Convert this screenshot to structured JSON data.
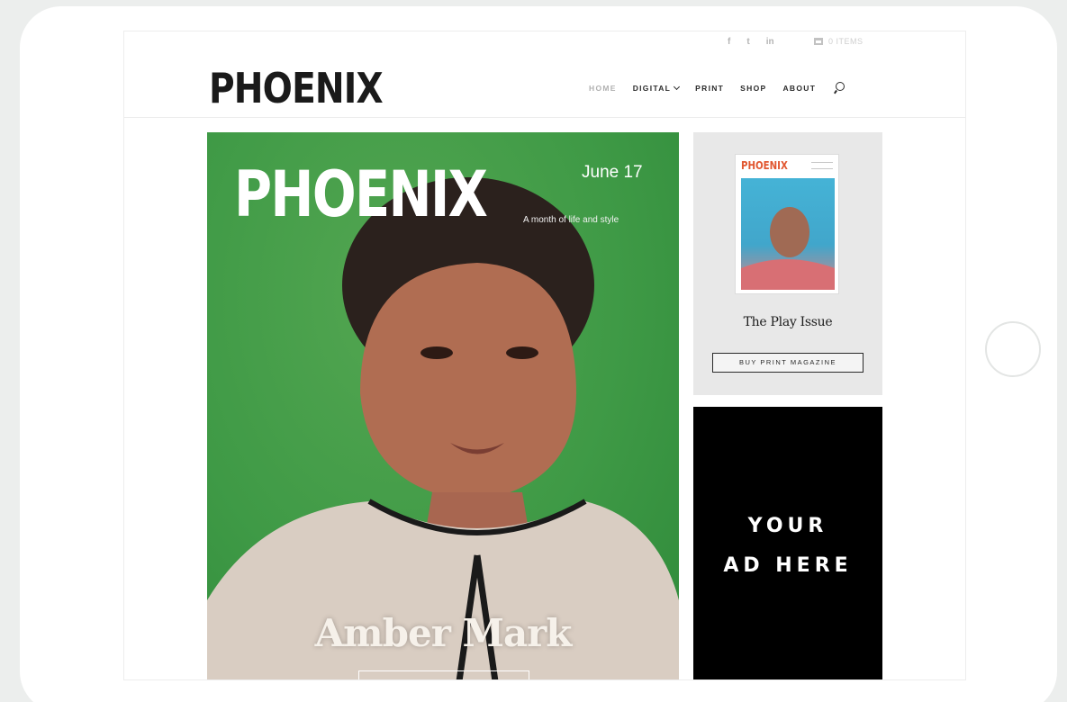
{
  "header": {
    "logo": "PHOENIX",
    "social": [
      "f",
      "t",
      "in"
    ],
    "cart_text": "0 ITEMS",
    "nav": {
      "home": "HOME",
      "digital": "DIGITAL",
      "print": "PRINT",
      "shop": "SHOP",
      "about": "ABOUT"
    }
  },
  "hero": {
    "title": "PHOENIX",
    "date": "June 17",
    "tagline": "A month of life and style",
    "name": "Amber Mark"
  },
  "sidebar": {
    "cover_logo": "PHOENIX",
    "issue_title": "The Play Issue",
    "buy_label": "BUY PRINT MAGAZINE"
  },
  "ad": {
    "line1": "YOUR",
    "line2": "AD HERE"
  }
}
